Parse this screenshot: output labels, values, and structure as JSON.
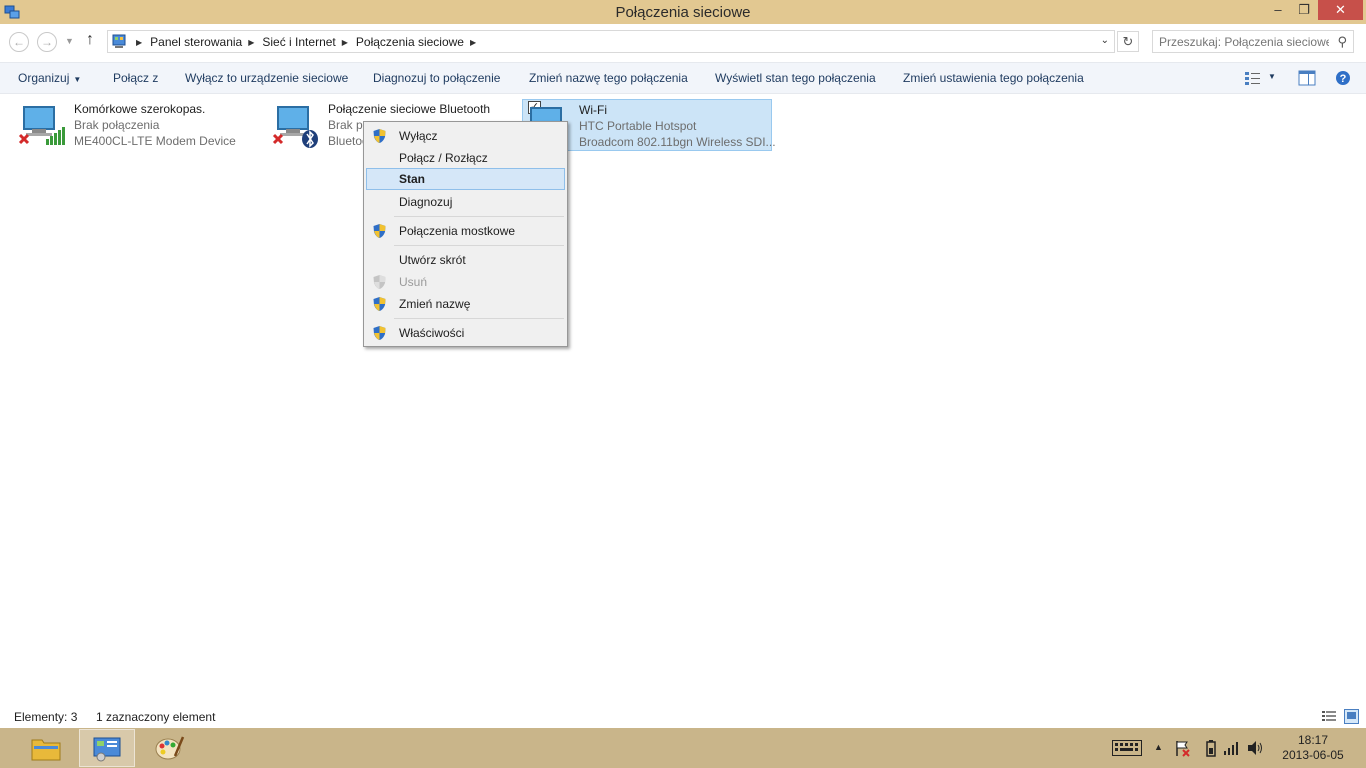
{
  "window": {
    "title": "Połączenia sieciowe",
    "min_symbol": "–",
    "max_symbol": "❐",
    "close_symbol": "✕"
  },
  "address": {
    "crumbs": [
      "Panel sterowania",
      "Sieć i Internet",
      "Połączenia sieciowe"
    ],
    "search_placeholder": "Przeszukaj: Połączenia sieciowe"
  },
  "toolbar": {
    "organize": "Organizuj",
    "connect": "Połącz z",
    "disable": "Wyłącz to urządzenie sieciowe",
    "diagnose": "Diagnozuj to połączenie",
    "rename": "Zmień nazwę tego połączenia",
    "view_status": "Wyświetl stan tego połączenia",
    "change_settings": "Zmień ustawienia tego połączenia"
  },
  "connections": [
    {
      "name": "Komórkowe szerokopas.",
      "status": "Brak połączenia",
      "device": "ME400CL-LTE Modem Device"
    },
    {
      "name": "Połączenie sieciowe Bluetooth",
      "status": "Brak po",
      "device": "Bluetoo"
    },
    {
      "name": "Wi-Fi",
      "status": "HTC Portable Hotspot",
      "device": "Broadcom 802.11bgn Wireless SDI..."
    }
  ],
  "context_menu": {
    "disable": "Wyłącz",
    "connect": "Połącz / Rozłącz",
    "status": "Stan",
    "diagnose": "Diagnozuj",
    "bridge": "Połączenia mostkowe",
    "shortcut": "Utwórz skrót",
    "delete": "Usuń",
    "rename": "Zmień nazwę",
    "properties": "Właściwości"
  },
  "statusbar": {
    "count": "Elementy: 3",
    "selected": "1 zaznaczony element"
  },
  "taskbar": {
    "time": "18:17",
    "date": "2013-06-05"
  },
  "colors": {
    "titlebar": "#e2c891",
    "taskbar": "#c9b58a",
    "selection": "#cce4f7",
    "close_button": "#c7504a"
  }
}
